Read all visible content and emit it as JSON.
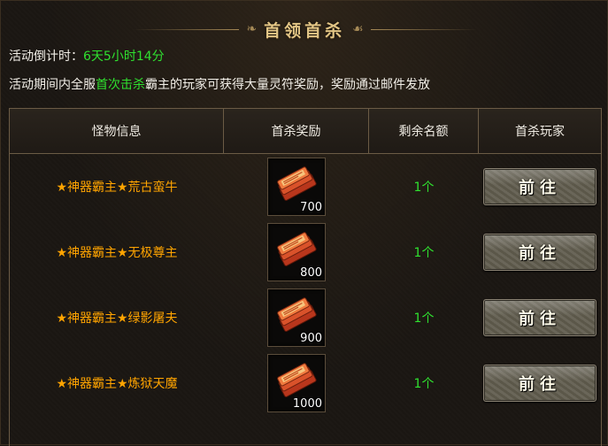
{
  "header": {
    "title": "首领首杀"
  },
  "countdown": {
    "label": "活动倒计时：",
    "value": "6天5小时14分"
  },
  "notice": {
    "prefix": "活动期间内全服",
    "highlight": "首次击杀",
    "suffix": "霸主的玩家可获得大量灵符奖励，奖励通过邮件发放"
  },
  "table": {
    "columns": [
      "怪物信息",
      "首杀奖励",
      "剩余名额",
      "首杀玩家"
    ],
    "rows": [
      {
        "monster": "★神器霸主★荒古蛮牛",
        "reward_icon": "spirit-talisman-icon",
        "reward_qty": "700",
        "quota": "1个",
        "action": "前往"
      },
      {
        "monster": "★神器霸主★无极尊主",
        "reward_icon": "spirit-talisman-icon",
        "reward_qty": "800",
        "quota": "1个",
        "action": "前往"
      },
      {
        "monster": "★神器霸主★绿影屠夫",
        "reward_icon": "spirit-talisman-icon",
        "reward_qty": "900",
        "quota": "1个",
        "action": "前往"
      },
      {
        "monster": "★神器霸主★炼狱天魔",
        "reward_icon": "spirit-talisman-icon",
        "reward_qty": "1000",
        "quota": "1个",
        "action": "前往"
      }
    ]
  },
  "colors": {
    "monster_name": "#ffa400",
    "highlight_green": "#2fe02f",
    "title_gold": "#e2c585",
    "background": "#1a1612"
  }
}
